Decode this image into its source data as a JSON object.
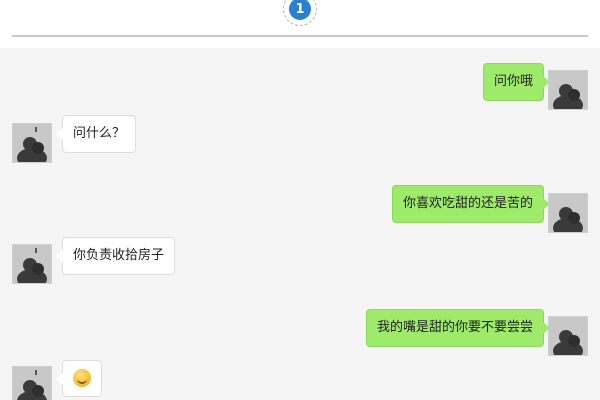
{
  "header": {
    "badge_count": "1"
  },
  "messages": [
    {
      "sender": "me",
      "text": "问你哦"
    },
    {
      "sender": "other",
      "text": "问什么？"
    },
    {
      "sender": "me",
      "text": "你喜欢吃甜的还是苦的"
    },
    {
      "sender": "other",
      "text": "你负责收拾房子"
    },
    {
      "sender": "me",
      "text": "我的嘴是甜的你要不要尝尝"
    },
    {
      "sender": "other",
      "emoji": "laughing-face-emoji"
    }
  ],
  "colors": {
    "my_bubble": "#9eea6a",
    "other_bubble": "#ffffff",
    "badge": "#2a7fd2",
    "background": "#f5f5f5"
  }
}
